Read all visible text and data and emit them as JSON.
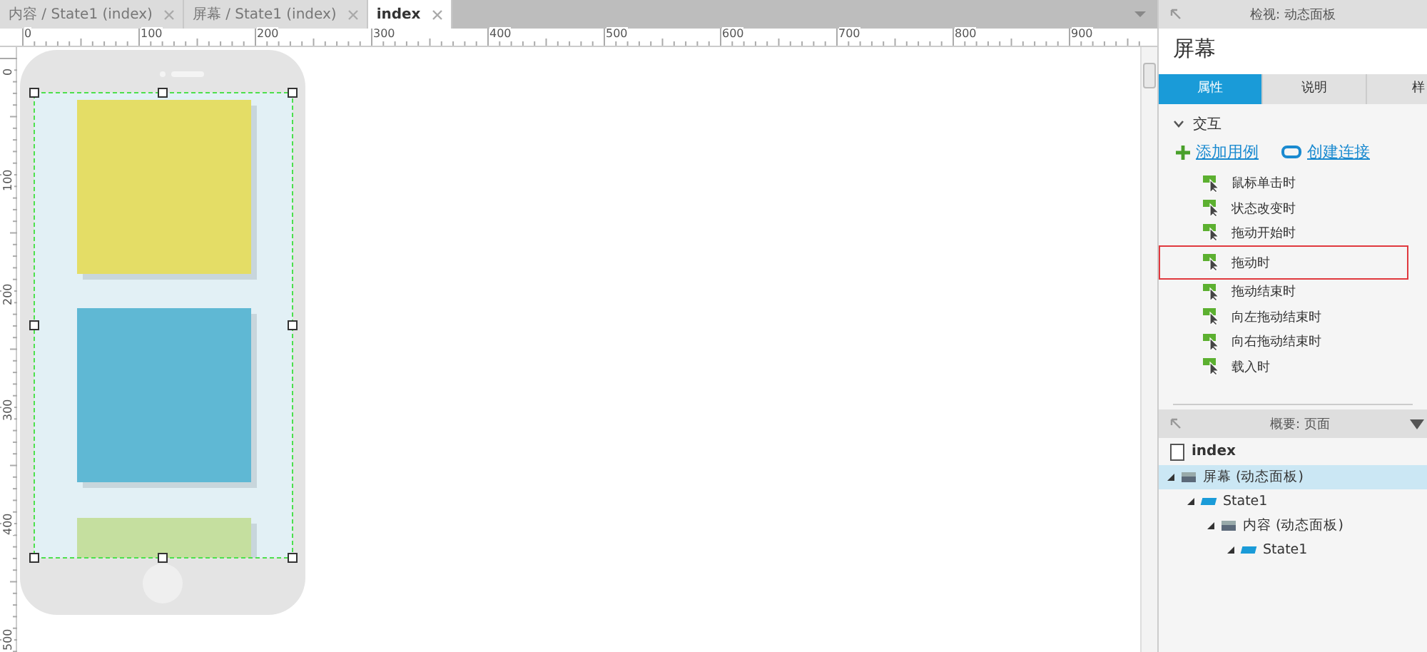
{
  "tabs": [
    {
      "label": "内容 / State1 (index)",
      "selected": false
    },
    {
      "label": "屏幕 / State1 (index)",
      "selected": false
    },
    {
      "label": "index",
      "selected": true
    }
  ],
  "ruler": {
    "x_labels": [
      "0",
      "100",
      "200",
      "300",
      "400",
      "500",
      "600",
      "700",
      "800",
      "900"
    ],
    "y_labels": [
      "0",
      "100",
      "200",
      "300",
      "400",
      "500"
    ]
  },
  "canvas": {
    "panels": [
      {
        "color": "#e4dd66"
      },
      {
        "color": "#5fb8d4"
      },
      {
        "color": "#c5df9f"
      }
    ]
  },
  "inspector": {
    "header": "检视: 动态面板",
    "title": "屏幕",
    "tabs": [
      {
        "label": "属性",
        "selected": true
      },
      {
        "label": "说明",
        "selected": false
      },
      {
        "label": "样",
        "selected": false
      }
    ],
    "section": {
      "label": "交互",
      "expanded": true
    },
    "actions": [
      {
        "label": "添加用例",
        "kind": "add"
      },
      {
        "label": "创建连接",
        "kind": "link"
      }
    ],
    "events": [
      {
        "label": "鼠标单击时",
        "selected": false
      },
      {
        "label": "状态改变时",
        "selected": false
      },
      {
        "label": "拖动开始时",
        "selected": false
      },
      {
        "label": "拖动时",
        "selected": true
      },
      {
        "label": "拖动结束时",
        "selected": false
      },
      {
        "label": "向左拖动结束时",
        "selected": false
      },
      {
        "label": "向右拖动结束时",
        "selected": false
      },
      {
        "label": "载入时",
        "selected": false
      }
    ]
  },
  "outline": {
    "header": "概要: 页面",
    "page": "index",
    "tree": [
      {
        "label": "屏幕 (动态面板)",
        "kind": "panel",
        "selected": true,
        "expanded": true,
        "children": [
          {
            "label": "State1",
            "kind": "state",
            "selected": false,
            "expanded": true,
            "children": [
              {
                "label": "内容 (动态面板)",
                "kind": "panel",
                "selected": false,
                "expanded": true,
                "children": [
                  {
                    "label": "State1",
                    "kind": "state",
                    "selected": false,
                    "expanded": true
                  }
                ]
              }
            ]
          }
        ]
      }
    ]
  }
}
